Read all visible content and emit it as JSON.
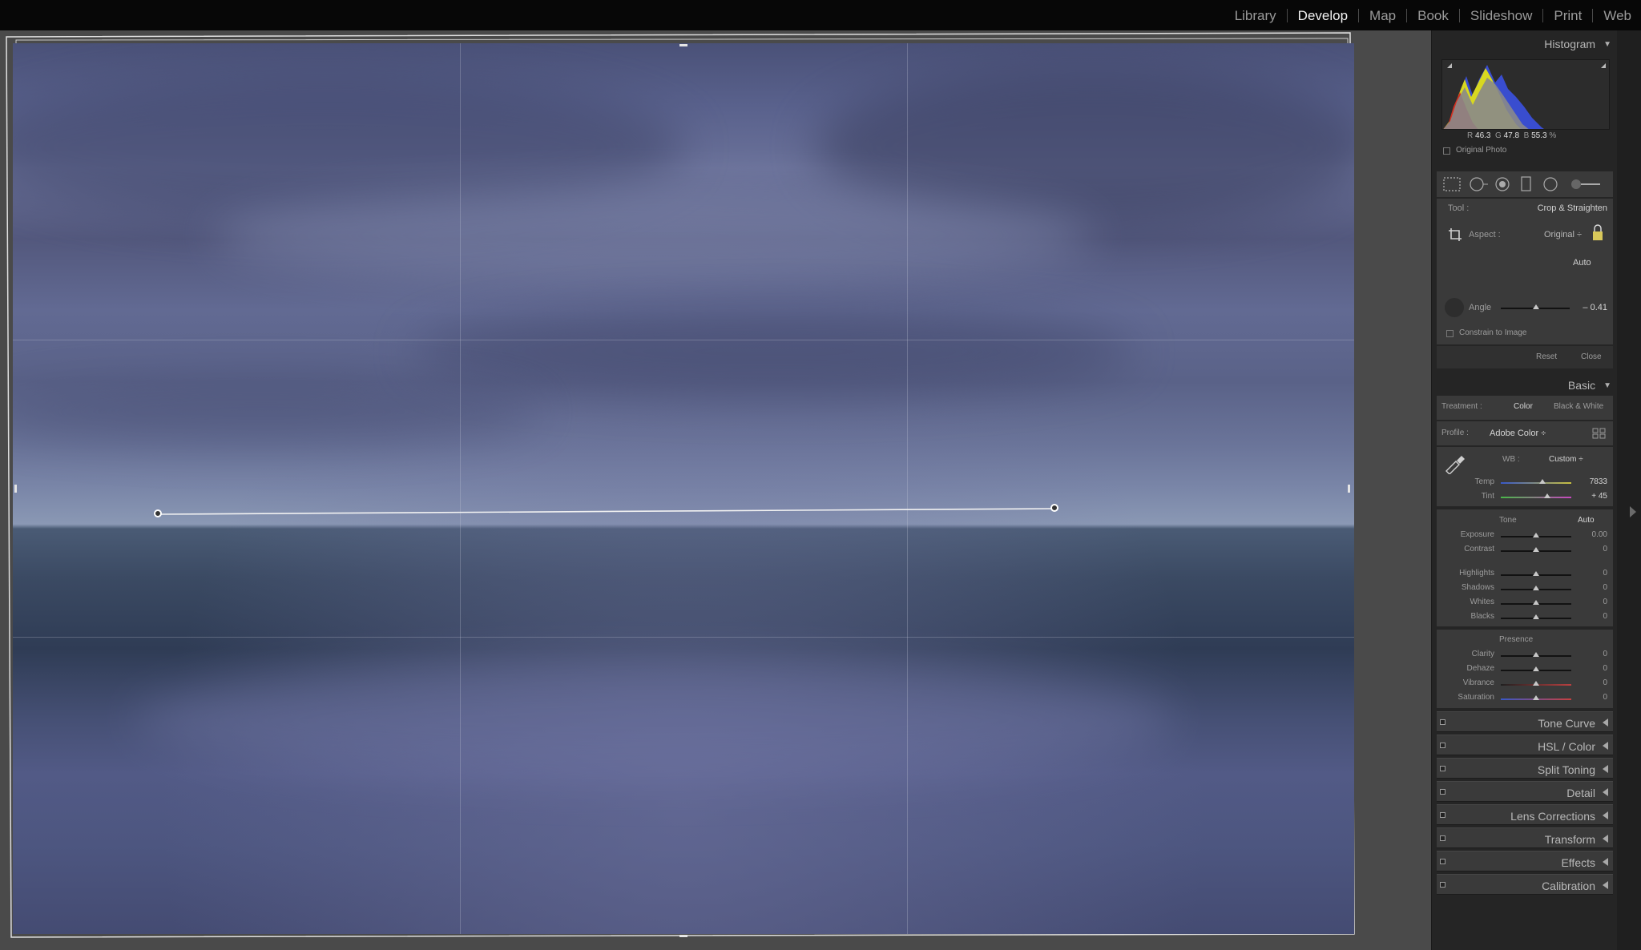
{
  "modules": [
    "Library",
    "Develop",
    "Map",
    "Book",
    "Slideshow",
    "Print",
    "Web"
  ],
  "active_module": "Develop",
  "histogram": {
    "title": "Histogram",
    "r_label": "R",
    "r_value": "46.3",
    "g_label": "G",
    "g_value": "47.8",
    "b_label": "B",
    "b_value": "55.3",
    "unit": "%",
    "original_photo": "Original Photo"
  },
  "crop": {
    "tool_label": "Tool :",
    "tool_value": "Crop & Straighten",
    "aspect_label": "Aspect :",
    "aspect_value": "Original ÷",
    "auto": "Auto",
    "angle_label": "Angle",
    "angle_value": "– 0.41",
    "constrain": "Constrain to Image",
    "reset": "Reset",
    "close": "Close"
  },
  "basic": {
    "title": "Basic",
    "treatment_label": "Treatment :",
    "color": "Color",
    "bw": "Black & White",
    "profile_label": "Profile :",
    "profile_value": "Adobe Color ÷",
    "wb_label": "WB :",
    "wb_value": "Custom ÷",
    "temp_label": "Temp",
    "temp_value": "7833",
    "tint_label": "Tint",
    "tint_value": "+ 45",
    "tone_label": "Tone",
    "tone_auto": "Auto",
    "tone": [
      {
        "label": "Exposure",
        "value": "0.00"
      },
      {
        "label": "Contrast",
        "value": "0"
      },
      {
        "label": "Highlights",
        "value": "0"
      },
      {
        "label": "Shadows",
        "value": "0"
      },
      {
        "label": "Whites",
        "value": "0"
      },
      {
        "label": "Blacks",
        "value": "0"
      }
    ],
    "presence_label": "Presence",
    "presence": [
      {
        "label": "Clarity",
        "value": "0"
      },
      {
        "label": "Dehaze",
        "value": "0"
      },
      {
        "label": "Vibrance",
        "value": "0"
      },
      {
        "label": "Saturation",
        "value": "0"
      }
    ]
  },
  "collapsed_panels": [
    "Tone Curve",
    "HSL / Color",
    "Split Toning",
    "Detail",
    "Lens Corrections",
    "Transform",
    "Effects",
    "Calibration"
  ],
  "colors": {
    "active": "#f2f2f2",
    "panel_bg": "#252525",
    "section_bg": "#3a3a3a"
  }
}
